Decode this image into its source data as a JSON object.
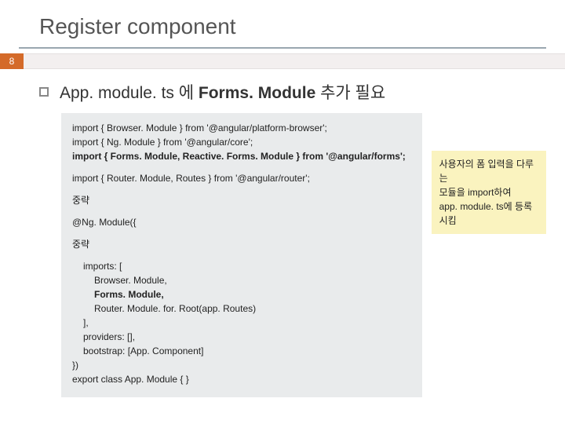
{
  "title": "Register component",
  "page_number": "8",
  "subtitle_prefix": "App. module. ts 에 ",
  "subtitle_bold": "Forms. Module",
  "subtitle_suffix": " 추가 필요",
  "code": {
    "l1": "import { Browser. Module } from '@angular/platform-browser';",
    "l2": "import { Ng. Module } from '@angular/core';",
    "l3": "import { Forms. Module, Reactive. Forms. Module } from '@angular/forms';",
    "l4": "import { Router. Module, Routes } from '@angular/router';",
    "l5": "중략",
    "l6": "@Ng. Module({",
    "l7": "중략",
    "l8": "imports: [",
    "l9": "Browser. Module,",
    "l10": "Forms. Module,",
    "l11": "Router. Module. for. Root(app. Routes)",
    "l12": "],",
    "l13": "providers: [],",
    "l14": "bootstrap: [App. Component]",
    "l15": "})",
    "l16": "export class App. Module { }"
  },
  "note": {
    "l1": "사용자의 폼 입력을 다루는",
    "l2": "모듈을 import하여",
    "l3": "app. module. ts에 등록시킴"
  }
}
